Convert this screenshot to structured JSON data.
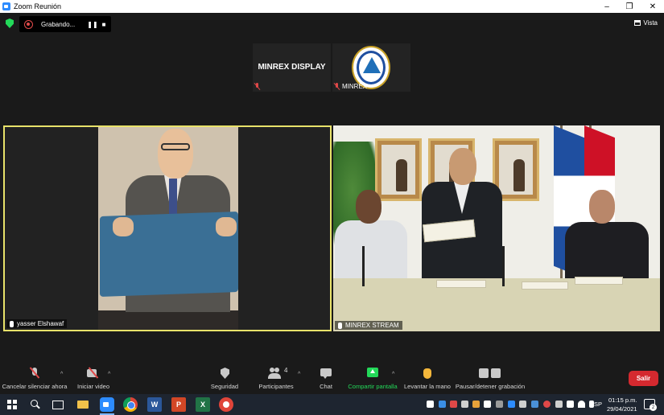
{
  "window": {
    "title": "Zoom Reunión",
    "minimize": "–",
    "maximize": "❐",
    "close": "✕"
  },
  "recording": {
    "status": "Grabando...",
    "pause": "❚❚",
    "stop": "■"
  },
  "view": {
    "label": "Vista"
  },
  "thumbnails": [
    {
      "display_name": "MINREX DISPLAY"
    },
    {
      "label": "MINREX"
    }
  ],
  "tiles": [
    {
      "name": "yasser Elshawaf"
    },
    {
      "name": "MINREX STREAM"
    }
  ],
  "toolbar": {
    "mute_label": "Cancelar silenciar ahora",
    "video_label": "Iniciar video",
    "security_label": "Seguridad",
    "participants_label": "Participantes",
    "participants_count": "4",
    "chat_label": "Chat",
    "share_label": "Compartir pantalla",
    "raise_hand_label": "Levantar la mano",
    "record_label": "Pausar/detener grabación",
    "leave_label": "Salir",
    "caret": "^"
  },
  "taskbar": {
    "word": "W",
    "powerpoint": "P",
    "excel": "X",
    "language": "ESP",
    "time": "01:15 p.m.",
    "date": "29/04/2021",
    "notifications": "2"
  },
  "colors": {
    "accent": "#2d8cff",
    "active_speaker_border": "#e8e26a",
    "share_green": "#23d959",
    "leave_red": "#d4292f",
    "muted_red": "#e04848"
  }
}
